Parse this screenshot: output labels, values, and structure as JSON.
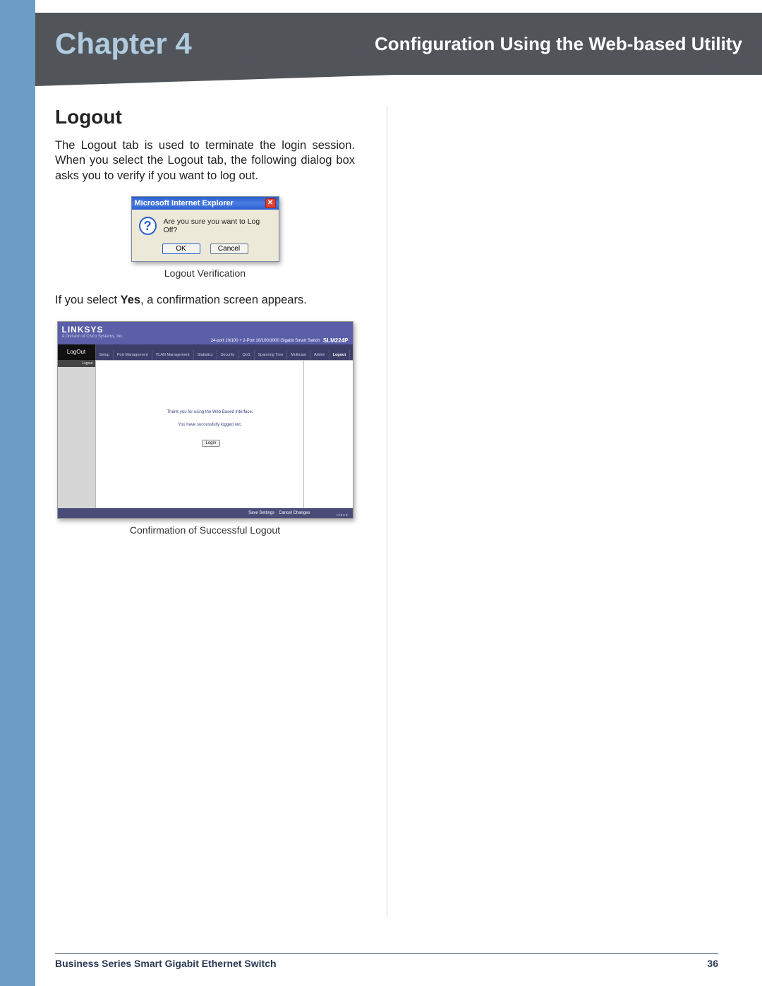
{
  "header": {
    "chapter": "Chapter 4",
    "subtitle": "Configuration Using the Web-based Utility"
  },
  "section": {
    "heading": "Logout",
    "intro": "The Logout tab is used to terminate the login session. When you select the Logout tab, the following dialog box asks you to verify if you want to log out.",
    "after_dialog_pre": "If you select ",
    "after_dialog_bold": "Yes",
    "after_dialog_post": ", a confirmation screen appears."
  },
  "dialog": {
    "title": "Microsoft Internet Explorer",
    "message": "Are you sure you want to Log Off?",
    "ok": "OK",
    "cancel": "Cancel",
    "caption": "Logout Verification"
  },
  "linksys": {
    "logo": "LINKSYS",
    "sub": "A Division of Cisco Systems, Inc.",
    "product": "24-port 10/100 + 2-Port 10/100/1000 Gigabit Smart Switch",
    "model": "SLM224P",
    "logout_tab": "LogOut",
    "tabs": [
      "Setup",
      "Port Management",
      "VLAN Management",
      "Statistics",
      "Security",
      "QoS",
      "Spanning Tree",
      "Multicast",
      "Admin",
      "Logout"
    ],
    "side_header": "Logout",
    "msg1": "Thank you for using the Web Based Interface.",
    "msg2": "You have successfully logged out.",
    "login_btn": "Login",
    "footer_save": "Save Settings",
    "footer_cancel": "Cancel Changes",
    "cisco": "cisco",
    "caption": "Confirmation of Successful Logout"
  },
  "footer": {
    "title": "Business Series Smart Gigabit Ethernet Switch",
    "page": "36"
  }
}
